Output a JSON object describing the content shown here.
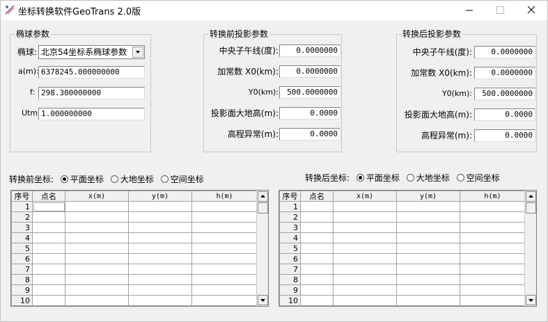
{
  "window": {
    "title": "坐标转换软件GeoTrans 2.0版"
  },
  "ellipsoid": {
    "title": "椭球参数",
    "label_ellipsoid": "椭球:",
    "selected": "北京54坐标系椭球参数",
    "label_a": "a(m):",
    "a": "6378245.000000000",
    "label_f": "f:",
    "f": "298.300000000",
    "label_utm": "Utm:",
    "utm": "1.000000000"
  },
  "before_proj": {
    "title": "转换前投影参数",
    "labels": [
      "中央子午线(度):",
      "加常数 X0(km):",
      "Y0(km):",
      "投影面大地高(m):",
      "高程异常(m):"
    ],
    "values": [
      "0.0000000",
      "0.0000000",
      "500.0000000",
      "0.0000",
      "0.0000"
    ]
  },
  "after_proj": {
    "title": "转换后投影参数",
    "labels": [
      "中央子午线(度):",
      "加常数 X0(km):",
      "Y0(km):",
      "投影面大地高(m):",
      "高程异常(m):"
    ],
    "values": [
      "0.0000000",
      "0.0000000",
      "500.0000000",
      "0.0000",
      "0.0000"
    ]
  },
  "before_coords": {
    "label": "转换前坐标:",
    "options": [
      "平面坐标",
      "大地坐标",
      "空间坐标"
    ],
    "selected_index": 0
  },
  "after_coords": {
    "label": "转换后坐标:",
    "options": [
      "平面坐标",
      "大地坐标",
      "空间坐标"
    ],
    "selected_index": 0
  },
  "table": {
    "columns": [
      "序号",
      "点名",
      "x(m)",
      "y(m)",
      "h(m)"
    ],
    "row_numbers": [
      "1",
      "2",
      "3",
      "4",
      "5",
      "6",
      "7",
      "8",
      "9",
      "10"
    ]
  }
}
